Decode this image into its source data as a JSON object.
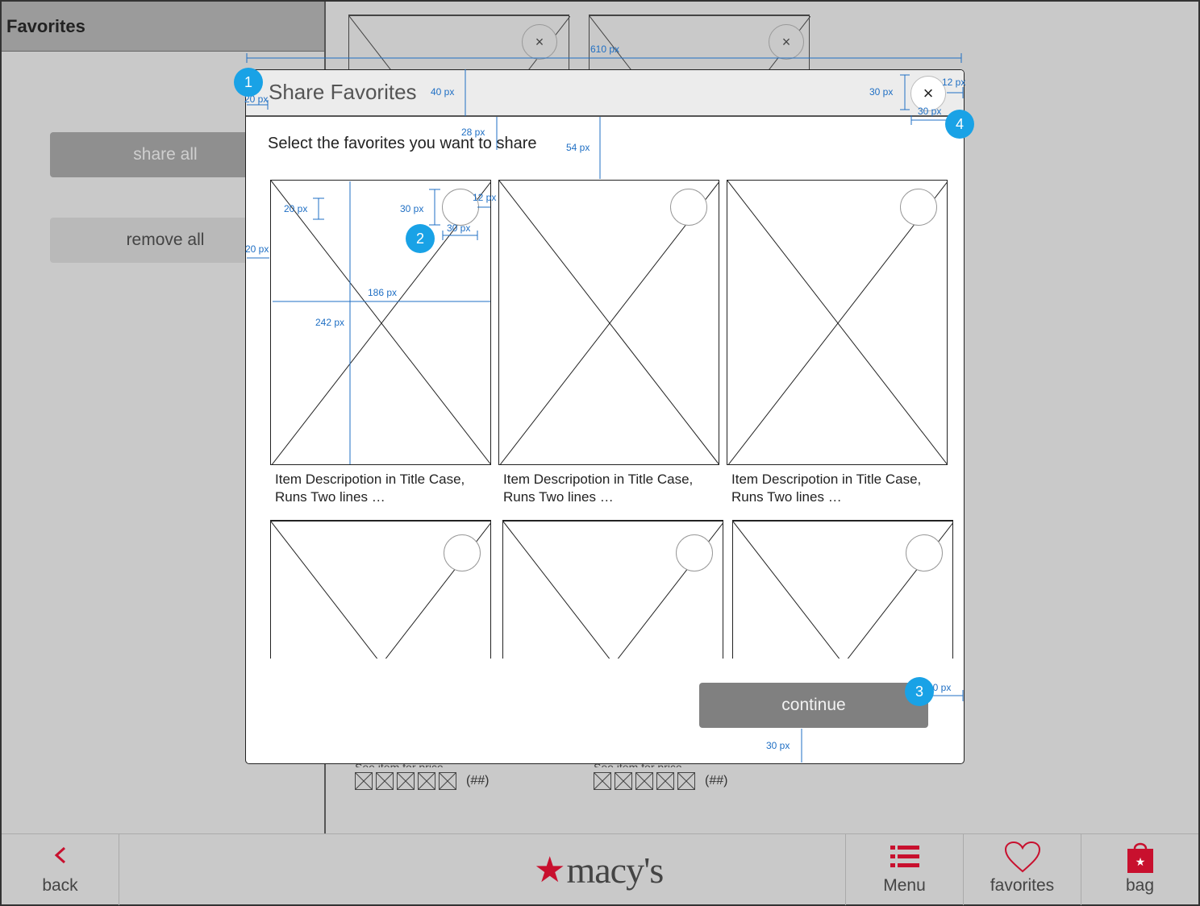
{
  "left_panel": {
    "title": "Favorites",
    "share_all_label": "share all",
    "remove_all_label": "remove all"
  },
  "background": {
    "close_glyph": "×",
    "review_count": "(##)",
    "price_label": "See item for price"
  },
  "modal": {
    "title": "Share Favorites",
    "close_glyph": "×",
    "subtitle": "Select the favorites you want to share",
    "items": [
      {
        "description": "Item Descripotion in Title Case, Runs Two lines …"
      },
      {
        "description": "Item Descripotion in Title Case, Runs Two lines …"
      },
      {
        "description": "Item Descripotion in Title Case, Runs Two lines …"
      },
      {
        "description": ""
      },
      {
        "description": ""
      },
      {
        "description": ""
      }
    ],
    "continue_label": "continue"
  },
  "annotations": {
    "modal_width": "610 px",
    "header_height": "40 px",
    "header_left_pad": "20 px",
    "close_size": "30 px",
    "close_right_pad": "12 px",
    "close_width": "30 px",
    "subtitle_top": "28 px",
    "grid_top": "54 px",
    "circle_top": "20 px",
    "circle_size": "30 px",
    "circle_right": "12 px",
    "circle_width": "30 px",
    "grid_left": "20 px",
    "item_width": "186 px",
    "item_height": "242 px",
    "continue_right": "20 px",
    "continue_bottom": "30 px",
    "badges": [
      "1",
      "2",
      "3",
      "4"
    ]
  },
  "bottom_bar": {
    "back_label": "back",
    "brand": "macy's",
    "menu_label": "Menu",
    "favorites_label": "favorites",
    "bag_label": "bag"
  },
  "colors": {
    "accent_red": "#c8102e",
    "annotation_blue": "#1f6fc4",
    "badge_blue": "#19a2e6"
  }
}
